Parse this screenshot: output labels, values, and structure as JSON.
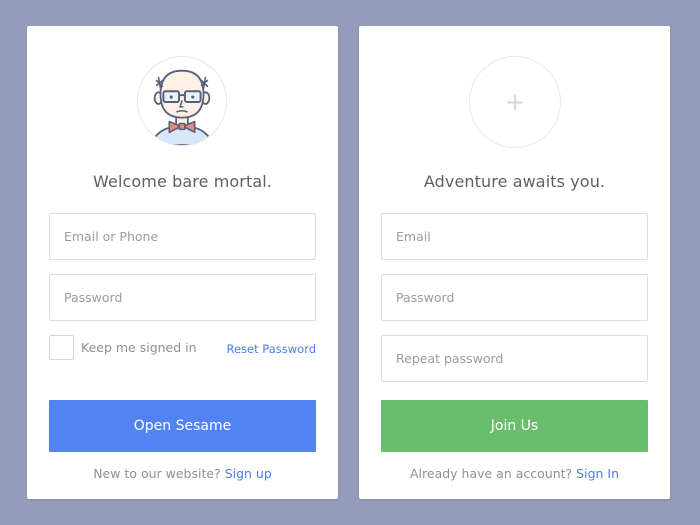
{
  "login": {
    "heading": "Welcome bare mortal.",
    "email_placeholder": "Email or Phone",
    "password_placeholder": "Password",
    "keep_signed_in_label": "Keep me signed in",
    "reset_password_label": "Reset Password",
    "submit_label": "Open Sesame",
    "footer_text": "New to our website?",
    "footer_link": "Sign up"
  },
  "signup": {
    "heading": "Adventure awaits you.",
    "email_placeholder": "Email",
    "password_placeholder": "Password",
    "repeat_password_placeholder": "Repeat password",
    "submit_label": "Join Us",
    "footer_text": "Already have an account?",
    "footer_link": "Sign In"
  },
  "icons": {
    "avatar": "bald-man-with-glasses-avatar-icon",
    "add_avatar": "plus-icon"
  },
  "colors": {
    "background": "#959cba",
    "card": "#ffffff",
    "primary_button": "#5183f2",
    "success_button": "#6abd6a",
    "link": "#4a7de9"
  }
}
